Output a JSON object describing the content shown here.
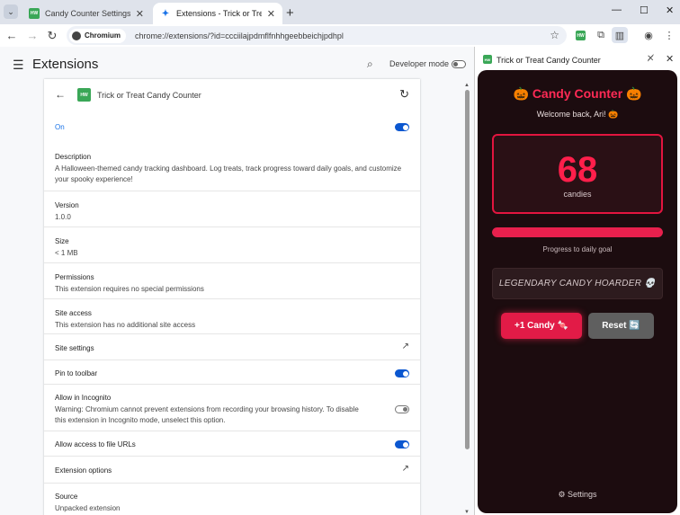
{
  "tabs": [
    {
      "title": "Candy Counter Settings",
      "favicon": "HW"
    },
    {
      "title": "Extensions - Trick or Treat Candy Counter",
      "favicon": "puzzle-icon"
    }
  ],
  "toolbar": {
    "chip_label": "Chromium",
    "url": "chrome://extensions/?id=ccciilajpdmflfnhhgeebbeichjpdhpl"
  },
  "main": {
    "title": "Extensions",
    "developer_mode_label": "Developer mode",
    "ext_logo": "HW",
    "ext_name": "Trick or Treat Candy Counter",
    "on_label": "On",
    "description_label": "Description",
    "description": "A Halloween-themed candy tracking dashboard. Log treats, track progress toward daily goals, and customize your spooky experience!",
    "version_label": "Version",
    "version": "1.0.0",
    "size_label": "Size",
    "size": "< 1 MB",
    "permissions_label": "Permissions",
    "permissions": "This extension requires no special permissions",
    "site_access_label": "Site access",
    "site_access": "This extension has no additional site access",
    "site_settings_label": "Site settings",
    "pin_label": "Pin to toolbar",
    "incognito_label": "Allow in Incognito",
    "incognito_warning": "Warning: Chromium cannot prevent extensions from recording your browsing history. To disable this extension in Incognito mode, unselect this option.",
    "file_urls_label": "Allow access to file URLs",
    "ext_options_label": "Extension options",
    "source_label": "Source",
    "source": "Unpacked extension"
  },
  "side_panel": {
    "logo": "HW",
    "title": "Trick or Treat Candy Counter",
    "app_title": "🎃 Candy Counter 🎃",
    "welcome": "Welcome back, Ari! 🎃",
    "count": "68",
    "count_unit": "candies",
    "progress_fraction": 1.0,
    "progress_label": "Progress to daily goal",
    "rank_title": "LEGENDARY CANDY HOARDER 💀",
    "add_button": "+1 Candy 🍬",
    "reset_button": "Reset 🔄",
    "settings_link": "⚙ Settings"
  },
  "colors": {
    "accent": "#ff2a55",
    "panel_bg": "#1c0c0f",
    "toggle_on": "#0b57d0"
  }
}
